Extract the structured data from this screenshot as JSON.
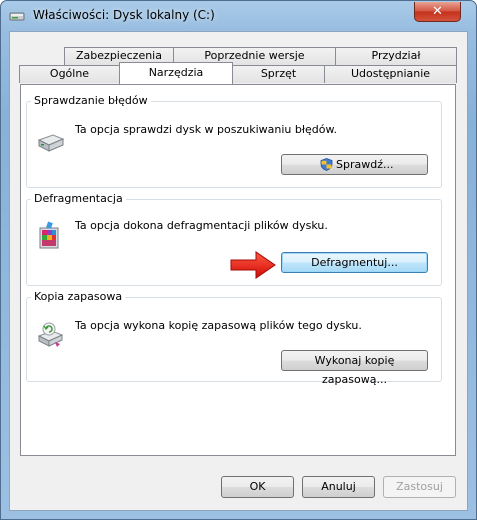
{
  "window": {
    "title": "Właściwości: Dysk lokalny (C:)",
    "close_glyph": "✕"
  },
  "tabs_top": [
    {
      "label": "Zabezpieczenia"
    },
    {
      "label": "Poprzednie wersje"
    },
    {
      "label": "Przydział"
    }
  ],
  "tabs_bottom": [
    {
      "label": "Ogólne"
    },
    {
      "label": "Narzędzia",
      "selected": true
    },
    {
      "label": "Sprzęt"
    },
    {
      "label": "Udostępnianie"
    }
  ],
  "groups": {
    "error_check": {
      "title": "Sprawdzanie błędów",
      "text": "Ta opcja sprawdzi dysk w poszukiwaniu błędów.",
      "button": "Sprawdź...",
      "icon": "hard-drive-icon"
    },
    "defrag": {
      "title": "Defragmentacja",
      "text": "Ta opcja dokona defragmentacji plików dysku.",
      "button": "Defragmentuj...",
      "icon": "defragment-icon"
    },
    "backup": {
      "title": "Kopia zapasowa",
      "text": "Ta opcja wykona kopię zapasową plików tego dysku.",
      "button": "Wykonaj kopię zapasową...",
      "icon": "backup-icon"
    }
  },
  "footer": {
    "ok": "OK",
    "cancel": "Anuluj",
    "apply": "Zastosuj"
  },
  "colors": {
    "arrow": "#e3120b",
    "frame": "#98bde0",
    "focus_button": "#bee6fd"
  }
}
